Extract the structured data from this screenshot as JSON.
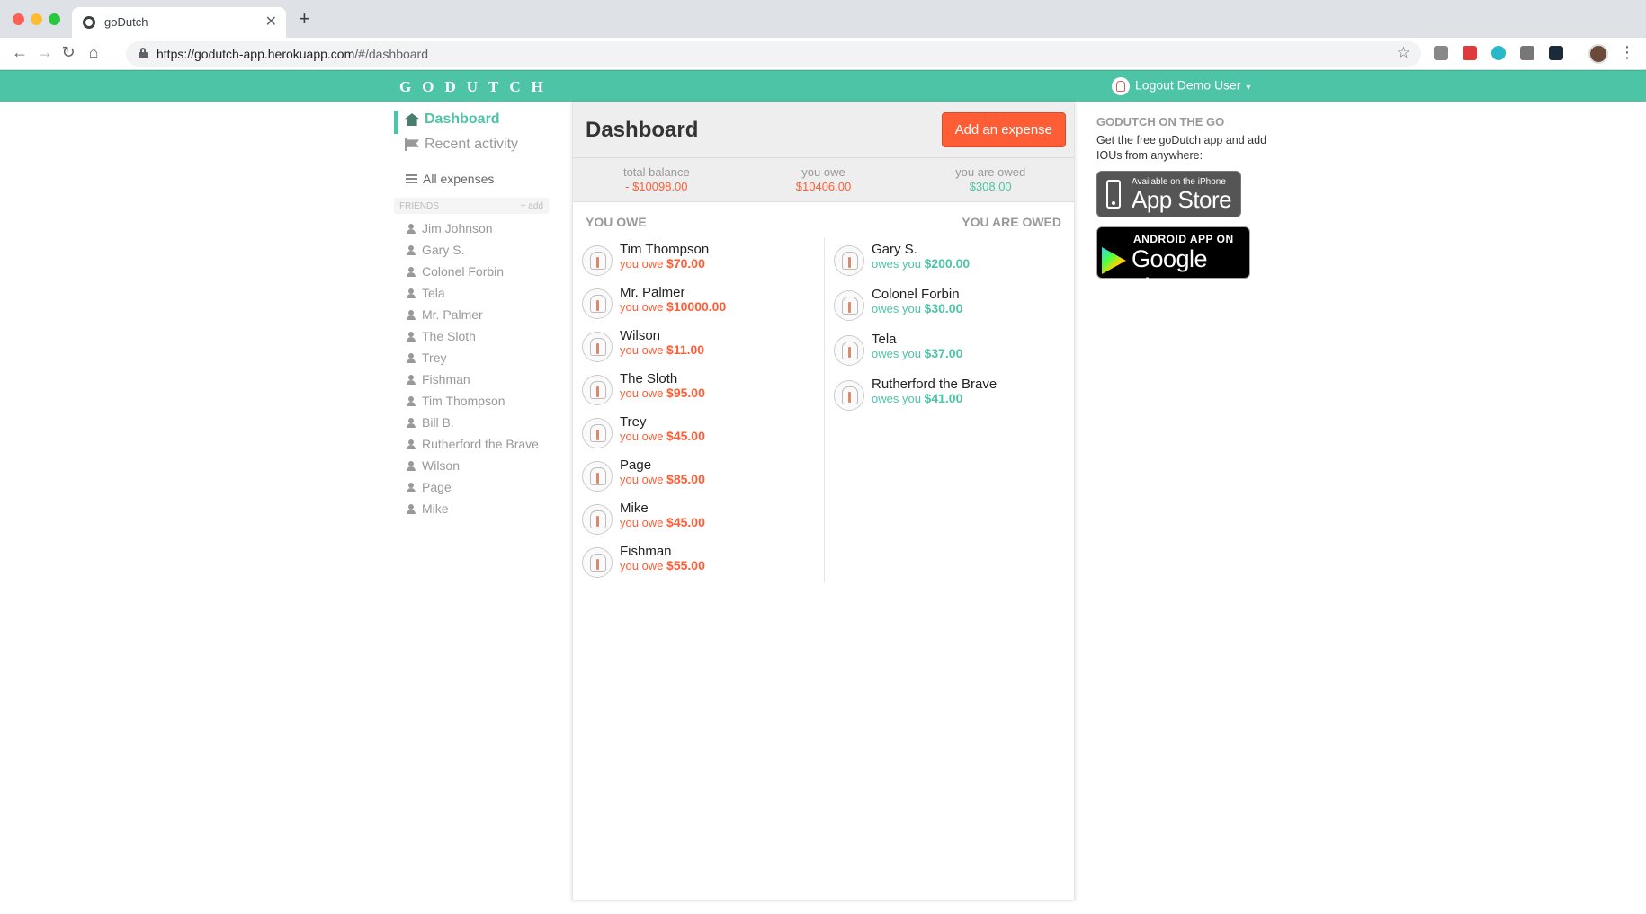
{
  "browser": {
    "tab_title": "goDutch",
    "url_host": "https://godutch-app.herokuapp.com",
    "url_path": "/#/dashboard"
  },
  "header": {
    "logo": "GODUTCH",
    "user_menu": "Logout Demo User"
  },
  "sidebar": {
    "dashboard": "Dashboard",
    "recent_activity": "Recent activity",
    "all_expenses": "All expenses",
    "friends_label": "FRIENDS",
    "add_label": "+ add",
    "friends": [
      "Jim Johnson",
      "Gary S.",
      "Colonel Forbin",
      "Tela",
      "Mr. Palmer",
      "The Sloth",
      "Trey",
      "Fishman",
      "Tim Thompson",
      "Bill B.",
      "Rutherford the Brave",
      "Wilson",
      "Page",
      "Mike"
    ]
  },
  "main": {
    "title": "Dashboard",
    "add_button": "Add an expense",
    "total_balance_label": "total balance",
    "total_balance": "- $10098.00",
    "you_owe_label": "you owe",
    "you_owe": "$10406.00",
    "you_are_owed_label": "you are owed",
    "you_are_owed": "$308.00",
    "you_owe_heading": "YOU OWE",
    "you_are_owed_heading": "YOU ARE OWED",
    "owe_prefix": "you owe",
    "owed_prefix": "owes you",
    "you_owe_list": [
      {
        "name": "Tim Thompson",
        "amount": "$70.00"
      },
      {
        "name": "Mr. Palmer",
        "amount": "$10000.00"
      },
      {
        "name": "Wilson",
        "amount": "$11.00"
      },
      {
        "name": "The Sloth",
        "amount": "$95.00"
      },
      {
        "name": "Trey",
        "amount": "$45.00"
      },
      {
        "name": "Page",
        "amount": "$85.00"
      },
      {
        "name": "Mike",
        "amount": "$45.00"
      },
      {
        "name": "Fishman",
        "amount": "$55.00"
      }
    ],
    "owed_list": [
      {
        "name": "Gary S.",
        "amount": "$200.00"
      },
      {
        "name": "Colonel Forbin",
        "amount": "$30.00"
      },
      {
        "name": "Tela",
        "amount": "$37.00"
      },
      {
        "name": "Rutherford the Brave",
        "amount": "$41.00"
      }
    ]
  },
  "promo": {
    "title": "GODUTCH ON THE GO",
    "text": "Get the free goDutch app and add IOUs from anywhere:",
    "appstore_small": "Available on the iPhone",
    "appstore_big": "App Store",
    "play_small": "ANDROID APP ON",
    "play_big": "Google play"
  },
  "colors": {
    "brand_teal": "#4dc4a5",
    "negative_orange": "#ff5d36"
  }
}
